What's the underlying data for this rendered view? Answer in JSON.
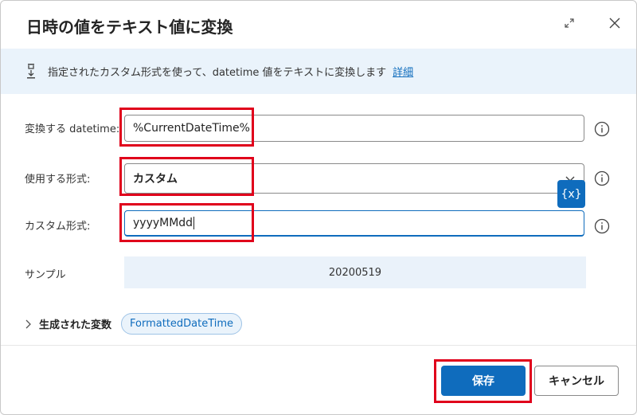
{
  "dialog": {
    "title": "日時の値をテキスト値に変換",
    "info_text": "指定されたカスタム形式を使って、datetime 値をテキストに変換します",
    "info_link": "詳細"
  },
  "fields": {
    "datetime_label": "変換する datetime:",
    "datetime_value": "%CurrentDateTime%",
    "format_label": "使用する形式:",
    "format_value": "カスタム",
    "custom_label": "カスタム形式:",
    "custom_value": "yyyyMMdd",
    "sample_label": "サンプル",
    "sample_value": "20200519"
  },
  "variables_button": "{x}",
  "generated": {
    "label": "生成された変数",
    "variable": "FormattedDateTime"
  },
  "buttons": {
    "save": "保存",
    "cancel": "キャンセル"
  },
  "colors": {
    "accent": "#0f6cbd",
    "highlight": "#e0001b",
    "info_bg": "#eaf3fb"
  }
}
